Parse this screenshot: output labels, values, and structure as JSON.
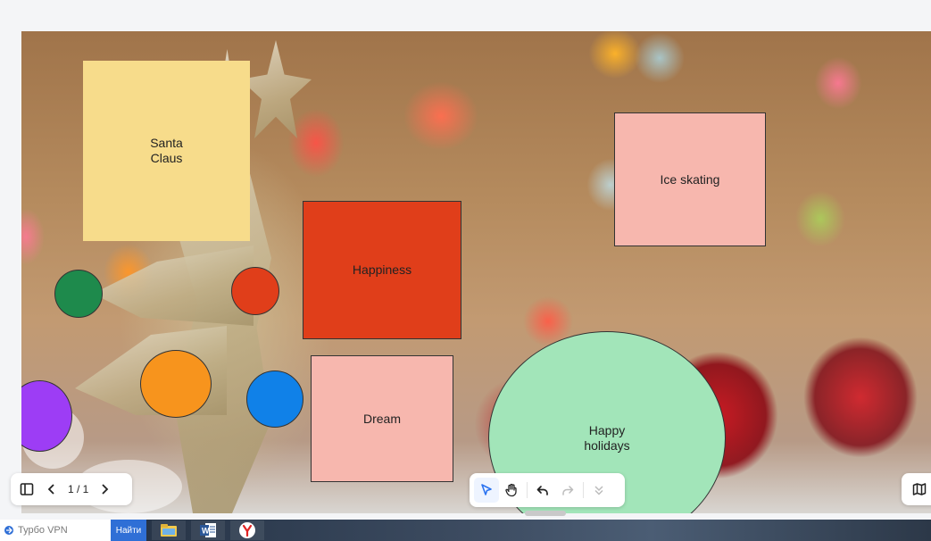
{
  "board": {
    "stickies": [
      {
        "label": "Santa\nClaus",
        "color": "#f7dc8b"
      },
      {
        "label": "Happiness",
        "color": "#e03e1a"
      },
      {
        "label": "Ice skating",
        "color": "#f7b7ae"
      },
      {
        "label": "Dream",
        "color": "#f7b7ae"
      }
    ],
    "big_circle": {
      "label": "Happy\nholidays",
      "color": "#a2e5b9"
    },
    "small_circles": [
      "#1e8a4c",
      "#e03e1a",
      "#f7941d",
      "#1081e8",
      "#9d3df5"
    ]
  },
  "pager": {
    "text": "1 / 1"
  },
  "toolbar": {
    "tools": [
      "select-tool",
      "hand-tool",
      "undo",
      "redo",
      "more"
    ]
  },
  "taskbar": {
    "search_placeholder": "Турбо VPN",
    "search_button": "Найти"
  }
}
